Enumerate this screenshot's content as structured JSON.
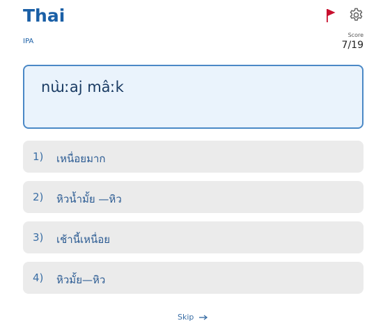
{
  "header": {
    "title": "Thai",
    "subtitle": "IPA",
    "flag_icon": "flag-icon",
    "settings_icon": "gear-icon"
  },
  "score": {
    "label": "Score",
    "value": "7/19"
  },
  "prompt": {
    "text": "nɯ̀ːaj mâːk"
  },
  "options": [
    {
      "number": "1)",
      "text": "เหนื่อยมาก"
    },
    {
      "number": "2)",
      "text": "หิวน้ำมั้ย —หิว"
    },
    {
      "number": "3)",
      "text": "เช้านี้เหนื่อย"
    },
    {
      "number": "4)",
      "text": "หิวมั้ย—หิว"
    }
  ],
  "skip": {
    "label": "Skip",
    "icon": "arrow-right-icon"
  },
  "colors": {
    "accent": "#1a5fa6",
    "flag": "#c8102e",
    "prompt_border": "#4a88c6",
    "prompt_bg": "#eaf3fc",
    "option_bg": "#ebebeb"
  }
}
